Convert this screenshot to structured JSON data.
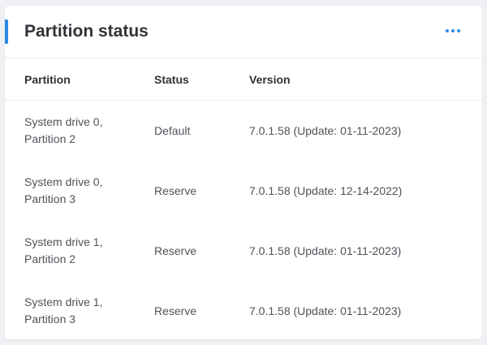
{
  "card": {
    "title": "Partition status",
    "more_icon": "more-horizontal-icon",
    "accent_color": "#2b8ae6"
  },
  "table": {
    "headers": {
      "partition": "Partition",
      "status": "Status",
      "version": "Version"
    },
    "rows": [
      {
        "partition_line1": "System drive 0,",
        "partition_line2": "Partition 2",
        "status": "Default",
        "version": "7.0.1.58 (Update: 01-11-2023)"
      },
      {
        "partition_line1": "System drive 0,",
        "partition_line2": "Partition 3",
        "status": "Reserve",
        "version": "7.0.1.58 (Update: 12-14-2022)"
      },
      {
        "partition_line1": "System drive 1,",
        "partition_line2": "Partition 2",
        "status": "Reserve",
        "version": "7.0.1.58 (Update: 01-11-2023)"
      },
      {
        "partition_line1": "System drive 1,",
        "partition_line2": "Partition 3",
        "status": "Reserve",
        "version": "7.0.1.58 (Update: 01-11-2023)"
      }
    ]
  }
}
